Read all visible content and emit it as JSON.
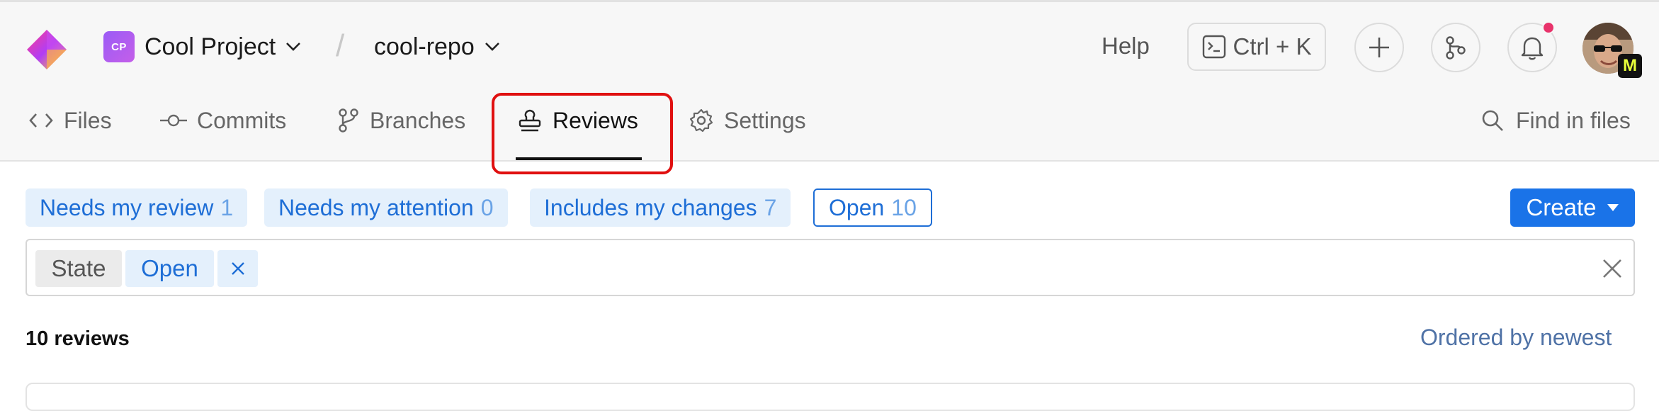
{
  "project": {
    "badge": "CP",
    "name": "Cool Project"
  },
  "repo": {
    "name": "cool-repo"
  },
  "header": {
    "help_label": "Help",
    "shortcut_label": "Ctrl + K",
    "notification_color": "#e8336b",
    "avatar_badge": "M"
  },
  "tabs": [
    {
      "label": "Files",
      "icon": "code-icon"
    },
    {
      "label": "Commits",
      "icon": "commit-icon"
    },
    {
      "label": "Branches",
      "icon": "branch-icon"
    },
    {
      "label": "Reviews",
      "icon": "stamp-icon",
      "active": true
    },
    {
      "label": "Settings",
      "icon": "gear-icon"
    }
  ],
  "find_label": "Find in files",
  "quick_filters": [
    {
      "label": "Needs my review",
      "count": "1"
    },
    {
      "label": "Needs my attention",
      "count": "0"
    },
    {
      "label": "Includes my changes",
      "count": "7"
    },
    {
      "label": "Open",
      "count": "10",
      "selected": true
    }
  ],
  "create_label": "Create",
  "filter": {
    "key": "State",
    "value": "Open"
  },
  "results": {
    "count_label": "10 reviews",
    "order_label": "Ordered by newest"
  },
  "colors": {
    "accent": "#1a73e8",
    "highlight": "#e01010",
    "chip_bg": "#e4f0fc"
  }
}
